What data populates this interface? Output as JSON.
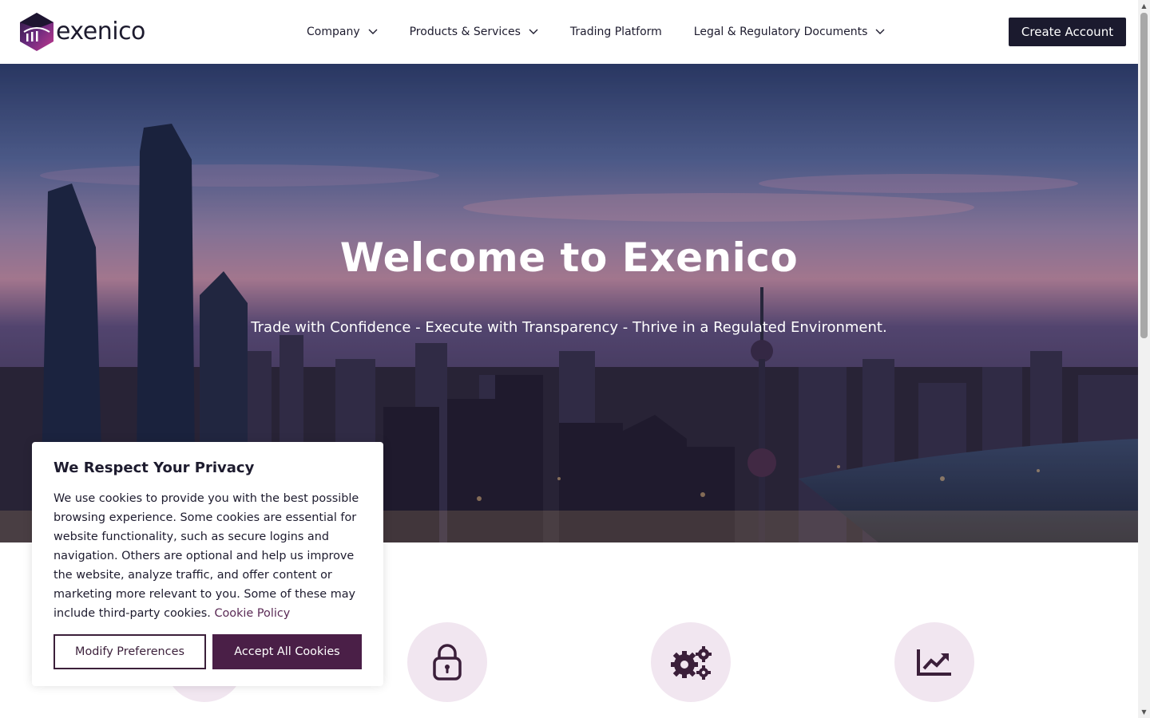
{
  "header": {
    "brand": "exenico",
    "nav": [
      {
        "label": "Company",
        "has_dropdown": true
      },
      {
        "label": "Products & Services",
        "has_dropdown": true
      },
      {
        "label": "Trading Platform",
        "has_dropdown": false
      },
      {
        "label": "Legal & Regulatory Documents",
        "has_dropdown": true
      }
    ],
    "cta_label": "Create Account"
  },
  "hero": {
    "title": "Welcome to Exenico",
    "subtitle": "Trade with Confidence - Execute with Transparency - Thrive in a Regulated Environment."
  },
  "features": [
    {
      "icon": "partially-hidden-icon"
    },
    {
      "icon": "lock-icon"
    },
    {
      "icon": "gears-icon"
    },
    {
      "icon": "chart-line-icon"
    }
  ],
  "cookie": {
    "title": "We Respect Your Privacy",
    "text": "We use cookies to provide you with the best possible browsing experience. Some cookies are essential for website functionality, such as secure logins and navigation. Others are optional and help us improve the website, analyze traffic, and offer content or marketing more relevant to you. Some of these may include third-party cookies.",
    "link_label": "Cookie Policy",
    "modify_label": "Modify Preferences",
    "accept_label": "Accept All Cookies"
  },
  "colors": {
    "brand_dark": "#1b1a2e",
    "accent_purple": "#4a1f47",
    "feature_bg": "#f1e6f0"
  }
}
